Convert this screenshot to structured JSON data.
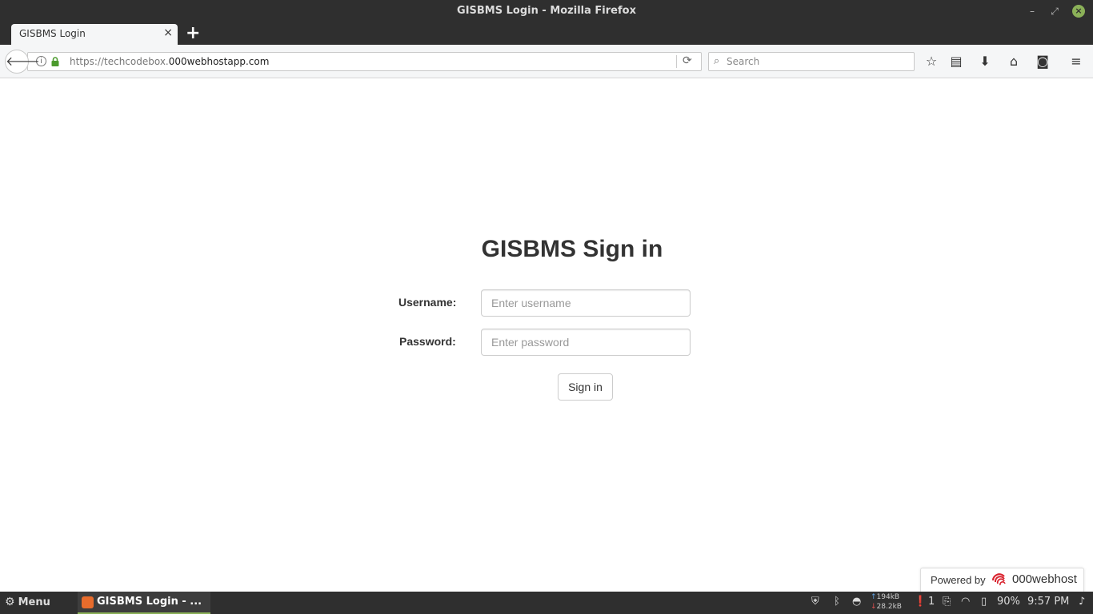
{
  "window": {
    "title": "GISBMS Login - Mozilla Firefox"
  },
  "tab": {
    "label": "GISBMS Login",
    "close": "×",
    "new_tab": "+"
  },
  "nav": {
    "url_prefix": "https://techcodebox.",
    "url_host": "000webhostapp.com",
    "search_placeholder": "Search"
  },
  "page": {
    "heading": "GISBMS Sign in",
    "username_label": "Username:",
    "username_placeholder": "Enter username",
    "password_label": "Password:",
    "password_placeholder": "Enter password",
    "signin_label": "Sign in",
    "powered_by": "Powered by",
    "brand": "000webhost"
  },
  "taskbar": {
    "menu_label": "Menu",
    "task_label": "GISBMS Login - ...",
    "net_up": "194kB",
    "net_down": "28.2kB",
    "notifications": "1",
    "battery": "90%",
    "clock": "9:57 PM"
  },
  "colors": {
    "chrome": "#2f2f2f",
    "toolbar": "#f5f6f7",
    "accent": "#8bb158"
  }
}
